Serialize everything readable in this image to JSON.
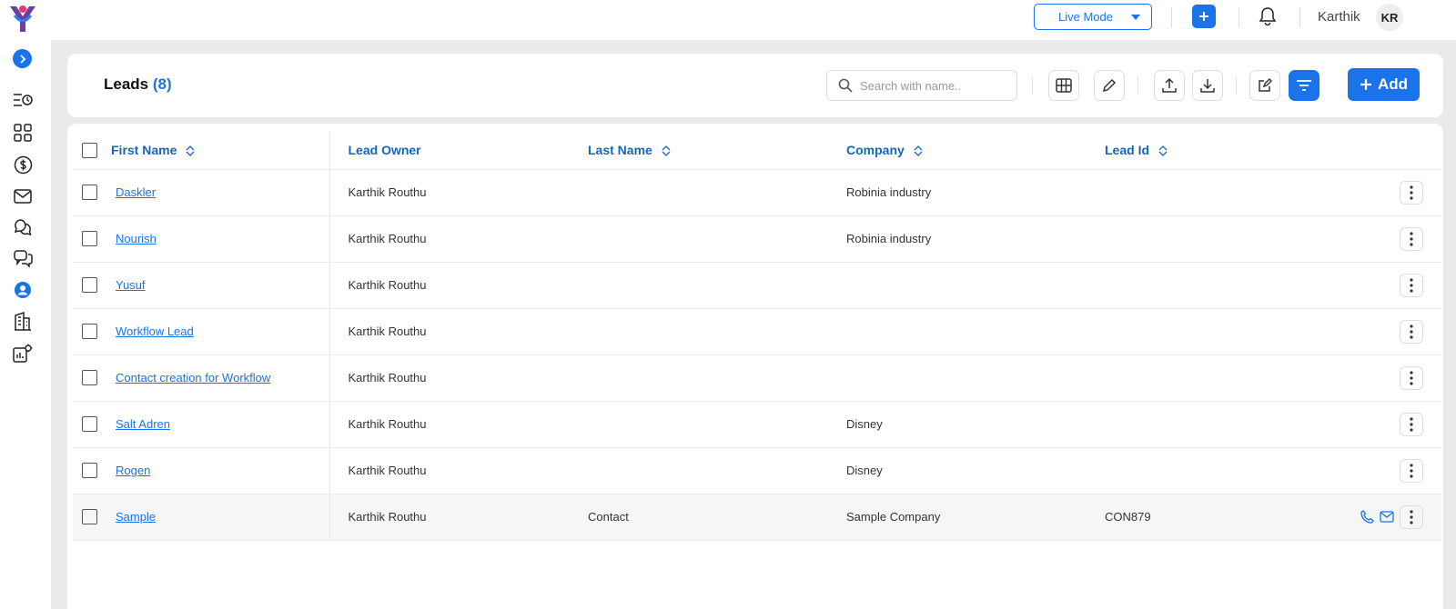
{
  "header": {
    "mode_label": "Live Mode",
    "user_name": "Karthik",
    "avatar_initials": "KR"
  },
  "page": {
    "title": "Leads",
    "count": "(8)",
    "search_placeholder": "Search with name..",
    "add_label": "Add"
  },
  "table": {
    "columns": [
      "First Name",
      "Lead Owner",
      "Last Name",
      "Company",
      "Lead Id"
    ],
    "rows": [
      {
        "first": "Daskler",
        "owner": "Karthik Routhu",
        "last": "",
        "company": "Robinia industry",
        "lead_id": ""
      },
      {
        "first": "Nourish",
        "owner": "Karthik Routhu",
        "last": "",
        "company": "Robinia industry",
        "lead_id": ""
      },
      {
        "first": "Yusuf",
        "owner": "Karthik Routhu",
        "last": "",
        "company": "",
        "lead_id": ""
      },
      {
        "first": "Workflow Lead",
        "owner": "Karthik Routhu",
        "last": "",
        "company": "",
        "lead_id": ""
      },
      {
        "first": "Contact creation for Workflow",
        "owner": "Karthik Routhu",
        "last": "",
        "company": "",
        "lead_id": ""
      },
      {
        "first": "Salt Adren",
        "owner": "Karthik Routhu",
        "last": "",
        "company": "Disney",
        "lead_id": ""
      },
      {
        "first": "Rogen",
        "owner": "Karthik Routhu",
        "last": "",
        "company": "Disney",
        "lead_id": ""
      },
      {
        "first": "Sample",
        "owner": "Karthik Routhu",
        "last": "Contact",
        "company": "Sample Company",
        "lead_id": "CON879"
      }
    ]
  },
  "colors": {
    "accent": "#1a73e8",
    "background": "#eaeaea"
  }
}
